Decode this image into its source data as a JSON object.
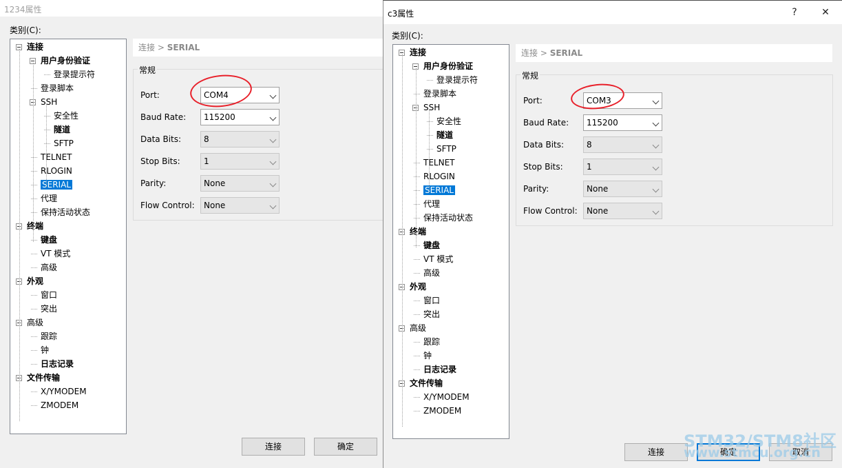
{
  "dialog1": {
    "title": "1234属性",
    "category_label": "类别(C):",
    "breadcrumb": {
      "parent": "连接 >",
      "current": "SERIAL"
    },
    "group_title": "常规",
    "fields": [
      {
        "label": "Port:",
        "value": "COM4",
        "enabled": true
      },
      {
        "label": "Baud Rate:",
        "value": "115200",
        "enabled": true
      },
      {
        "label": "Data Bits:",
        "value": "8",
        "enabled": false
      },
      {
        "label": "Stop Bits:",
        "value": "1",
        "enabled": false
      },
      {
        "label": "Parity:",
        "value": "None",
        "enabled": false
      },
      {
        "label": "Flow Control:",
        "value": "None",
        "enabled": false
      }
    ],
    "buttons": {
      "connect": "连接",
      "ok": "确定"
    }
  },
  "dialog2": {
    "title": "c3属性",
    "help_glyph": "?",
    "close_glyph": "✕",
    "category_label": "类别(C):",
    "breadcrumb": {
      "parent": "连接 >",
      "current": "SERIAL"
    },
    "group_title": "常规",
    "fields": [
      {
        "label": "Port:",
        "value": "COM3",
        "enabled": true
      },
      {
        "label": "Baud Rate:",
        "value": "115200",
        "enabled": true
      },
      {
        "label": "Data Bits:",
        "value": "8",
        "enabled": false
      },
      {
        "label": "Stop Bits:",
        "value": "1",
        "enabled": false
      },
      {
        "label": "Parity:",
        "value": "None",
        "enabled": false
      },
      {
        "label": "Flow Control:",
        "value": "None",
        "enabled": false
      }
    ],
    "buttons": {
      "connect": "连接",
      "ok": "确定",
      "cancel": "取消"
    }
  },
  "tree": [
    {
      "label": "连接",
      "level": 0,
      "bold": true,
      "expander": true
    },
    {
      "label": "用户身份验证",
      "level": 1,
      "bold": true,
      "expander": true
    },
    {
      "label": "登录提示符",
      "level": 2,
      "bold": false
    },
    {
      "label": "登录脚本",
      "level": 1,
      "bold": false
    },
    {
      "label": "SSH",
      "level": 1,
      "bold": false,
      "expander": true
    },
    {
      "label": "安全性",
      "level": 2,
      "bold": false
    },
    {
      "label": "隧道",
      "level": 2,
      "bold": true
    },
    {
      "label": "SFTP",
      "level": 2,
      "bold": false
    },
    {
      "label": "TELNET",
      "level": 1,
      "bold": false
    },
    {
      "label": "RLOGIN",
      "level": 1,
      "bold": false
    },
    {
      "label": "SERIAL",
      "level": 1,
      "bold": false,
      "selected": true
    },
    {
      "label": "代理",
      "level": 1,
      "bold": false
    },
    {
      "label": "保持活动状态",
      "level": 1,
      "bold": false
    },
    {
      "label": "终端",
      "level": 0,
      "bold": true,
      "expander": true
    },
    {
      "label": "键盘",
      "level": 1,
      "bold": true
    },
    {
      "label": "VT 模式",
      "level": 1,
      "bold": false
    },
    {
      "label": "高级",
      "level": 1,
      "bold": false
    },
    {
      "label": "外观",
      "level": 0,
      "bold": true,
      "expander": true
    },
    {
      "label": "窗口",
      "level": 1,
      "bold": false
    },
    {
      "label": "突出",
      "level": 1,
      "bold": false
    },
    {
      "label": "高级",
      "level": 0,
      "bold": false,
      "expander": true
    },
    {
      "label": "跟踪",
      "level": 1,
      "bold": false
    },
    {
      "label": "钟",
      "level": 1,
      "bold": false
    },
    {
      "label": "日志记录",
      "level": 1,
      "bold": true
    },
    {
      "label": "文件传输",
      "level": 0,
      "bold": true,
      "expander": true
    },
    {
      "label": "X/YMODEM",
      "level": 1,
      "bold": false
    },
    {
      "label": "ZMODEM",
      "level": 1,
      "bold": false
    }
  ],
  "watermark": {
    "line1": "STM32/STM8社区",
    "line2": "www.stmcu.org.cn"
  },
  "colors": {
    "selection": "#0078d7",
    "annotation_red": "#e8202a",
    "watermark": "#9ccbe8"
  }
}
